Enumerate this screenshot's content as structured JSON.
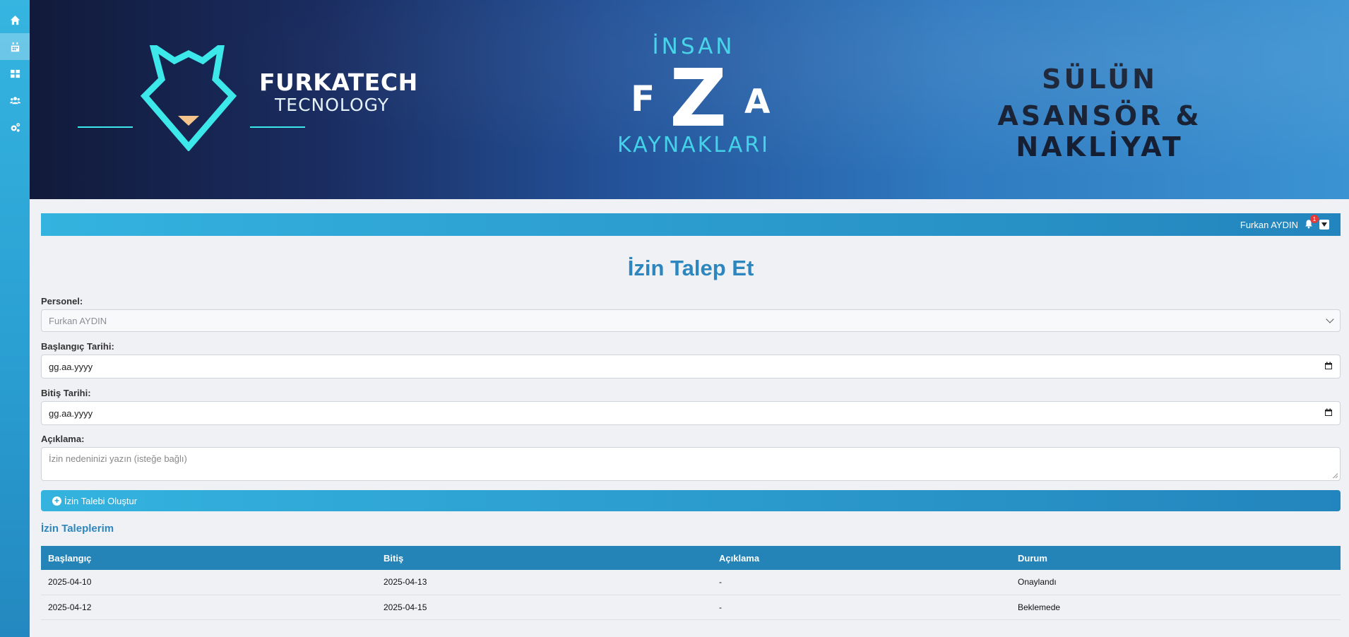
{
  "sidebar": {
    "items": [
      {
        "icon": "home-icon"
      },
      {
        "icon": "calendar-icon",
        "active": true
      },
      {
        "icon": "dashboard-icon"
      },
      {
        "icon": "users-icon"
      },
      {
        "icon": "settings-icon"
      }
    ]
  },
  "banner": {
    "brand_title": "FURKATECH",
    "brand_subtitle": "TECNOLOGY",
    "hr_top": "İNSAN",
    "hr_left_letter": "F",
    "hr_center_letter": "Z",
    "hr_right_letter": "A",
    "hr_bottom": "KAYNAKLARI",
    "company_line1": "SÜLÜN",
    "company_line2": "ASANSÖR & NAKLİYAT"
  },
  "topbar": {
    "user_name": "Furkan AYDIN",
    "notification_count": "1"
  },
  "form": {
    "title": "İzin Talep Et",
    "personnel_label": "Personel:",
    "personnel_value": "Furkan AYDIN",
    "start_label": "Başlangıç Tarihi:",
    "start_value": "gg.aa.yyyy",
    "end_label": "Bitiş Tarihi:",
    "end_value": "gg.aa.yyyy",
    "note_label": "Açıklama:",
    "note_placeholder": "İzin nedeninizi yazın (isteğe bağlı)",
    "submit_label": "İzin Talebi Oluştur"
  },
  "requests": {
    "title": "İzin Taleplerim",
    "columns": [
      "Başlangıç",
      "Bitiş",
      "Açıklama",
      "Durum"
    ],
    "rows": [
      [
        "2025-04-10",
        "2025-04-13",
        "-",
        "Onaylandı"
      ],
      [
        "2025-04-12",
        "2025-04-15",
        "-",
        "Beklemede"
      ]
    ]
  },
  "colors": {
    "accent": "#2d86bd",
    "bar_start": "#34b3df",
    "bar_end": "#2385bd",
    "logo_cyan": "#3de8ea"
  }
}
